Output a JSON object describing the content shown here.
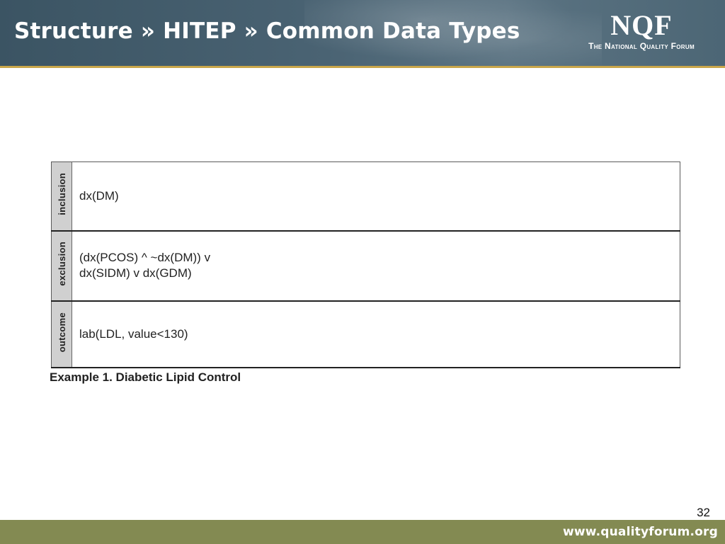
{
  "header": {
    "title": "Structure » HITEP » Common Data Types",
    "logo": {
      "mark": "NQF",
      "tagline": "The National Quality Forum"
    }
  },
  "table": {
    "rows": [
      {
        "label": "inclusion",
        "lines": [
          "dx(DM)"
        ]
      },
      {
        "label": "exclusion",
        "lines": [
          "(dx(PCOS) ^ ~dx(DM)) v",
          "dx(SIDM) v dx(GDM)"
        ]
      },
      {
        "label": "outcome",
        "lines": [
          "lab(LDL, value<130)"
        ]
      }
    ],
    "caption": "Example 1. Diabetic Lipid Control"
  },
  "footer": {
    "page_number": "32",
    "url": "www.qualityforum.org"
  }
}
